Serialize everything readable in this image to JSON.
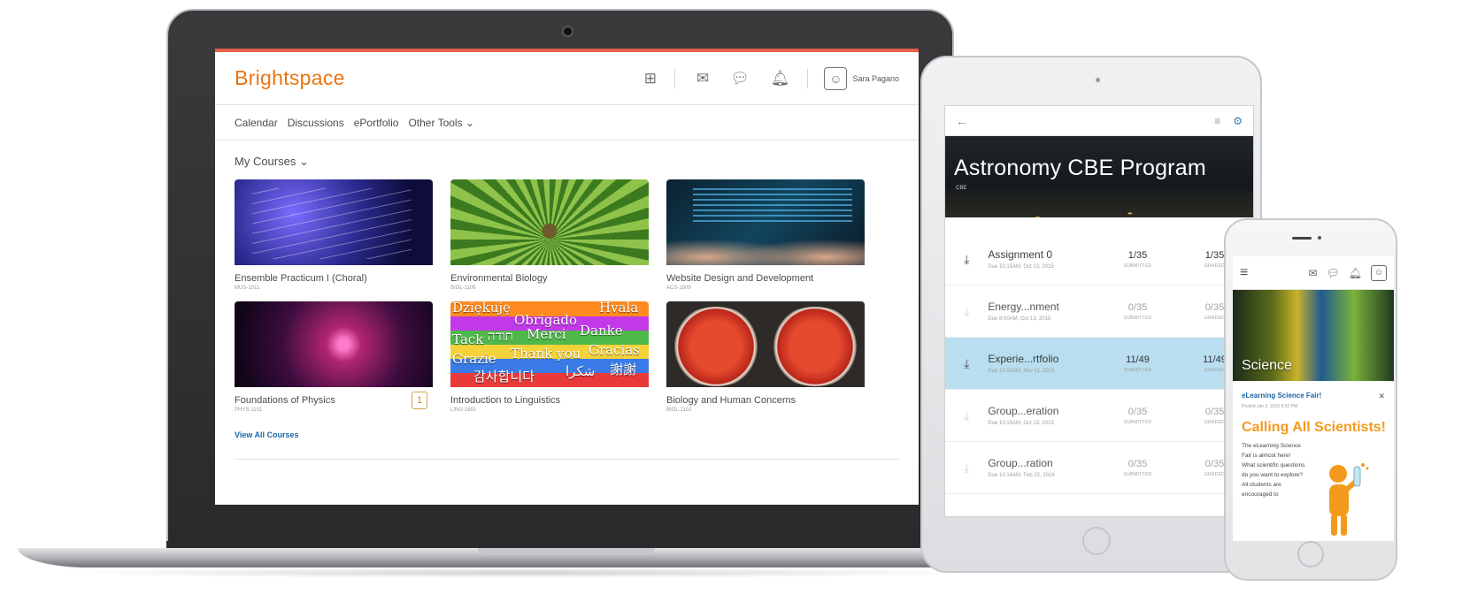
{
  "laptop": {
    "logo": "Brightspace",
    "user_name": "Sara Pagano",
    "nav": [
      "Calendar",
      "Discussions",
      "ePortfolio",
      "Other Tools ⌄"
    ],
    "widget_title": "My Courses ⌄",
    "courses": [
      {
        "name": "Ensemble Practicum I (Choral)",
        "code": "MUS-1011",
        "image": "music-conductor"
      },
      {
        "name": "Environmental Biology",
        "code": "BIOL-1106",
        "image": "tree-canopy"
      },
      {
        "name": "Website Design and Development",
        "code": "ACS-1809",
        "image": "code-hands"
      },
      {
        "name": "Foundations of Physics",
        "code": "PHYS-1101",
        "image": "plasma-ball",
        "badge": "1"
      },
      {
        "name": "Introduction to Linguistics",
        "code": "LING-1601",
        "image": "thank-you-words"
      },
      {
        "name": "Biology and Human Concerns",
        "code": "BIOL-1102",
        "image": "petri-dishes"
      }
    ],
    "view_all": "View All Courses",
    "word_tiles": [
      "Dziękuję",
      "Obrigado",
      "Hvala",
      "Tack",
      "תודה",
      "Merci",
      "Danke",
      "Grazie",
      "Thank you",
      "Gracias",
      "감사합니다",
      "شكرا",
      "謝謝"
    ]
  },
  "tablet": {
    "banner_title": "Astronomy CBE Program",
    "banner_sub": "CBE",
    "rows": [
      {
        "title": "Assignment 0",
        "due": "Due 10:15AM, Oct 13, 2015",
        "submitted": "1/35",
        "graded": "1/35",
        "submitted_label": "SUBMITTED",
        "graded_label": "GRADED",
        "state": "active"
      },
      {
        "title": "Energy...nment",
        "due": "Due 8:00AM, Oct 13, 2015",
        "submitted": "0/35",
        "graded": "0/35",
        "submitted_label": "SUBMITTED",
        "graded_label": "GRADED",
        "state": "dim"
      },
      {
        "title": "Experie...rtfolio",
        "due": "Due 10:00AM, Nov 11, 2015",
        "submitted": "11/49",
        "graded": "11/49",
        "submitted_label": "SUBMITTED",
        "graded_label": "GRADED",
        "state": "highlight"
      },
      {
        "title": "Group...eration",
        "due": "Due 10:15AM, Oct 13, 2015",
        "submitted": "0/35",
        "graded": "0/35",
        "submitted_label": "SUBMITTED",
        "graded_label": "GRADED",
        "state": "dim"
      },
      {
        "title": "Group...ration",
        "due": "Due 10:14AM, Feb 22, 2016",
        "submitted": "0/35",
        "graded": "0/35",
        "submitted_label": "SUBMITTED",
        "graded_label": "GRADED",
        "state": "dim"
      }
    ]
  },
  "phone": {
    "hero_title": "Science",
    "post_title": "eLearning Science Fair!",
    "post_date": "Posted Jan 2, 2013 8:22 PM",
    "headline": "Calling All Scientists!",
    "body": "The eLearning Science Fair is almost here! What scientific questions do you want to explore? All students are encouraged to"
  },
  "colors": {
    "brand_orange": "#e87511",
    "accent_red": "#e8604c",
    "link_blue": "#1b64a8",
    "highlight_row": "#b9deef",
    "headline_orange": "#f39a1d"
  },
  "icons": {
    "apps": "apps-grid-icon",
    "mail": "mail-icon",
    "chat": "chat-icon",
    "bell": "bell-icon",
    "avatar": "user-avatar-icon",
    "back": "back-arrow-icon",
    "sort": "sort-icon",
    "gear": "gear-icon",
    "download": "download-icon",
    "menu": "hamburger-menu-icon",
    "close": "close-icon"
  }
}
